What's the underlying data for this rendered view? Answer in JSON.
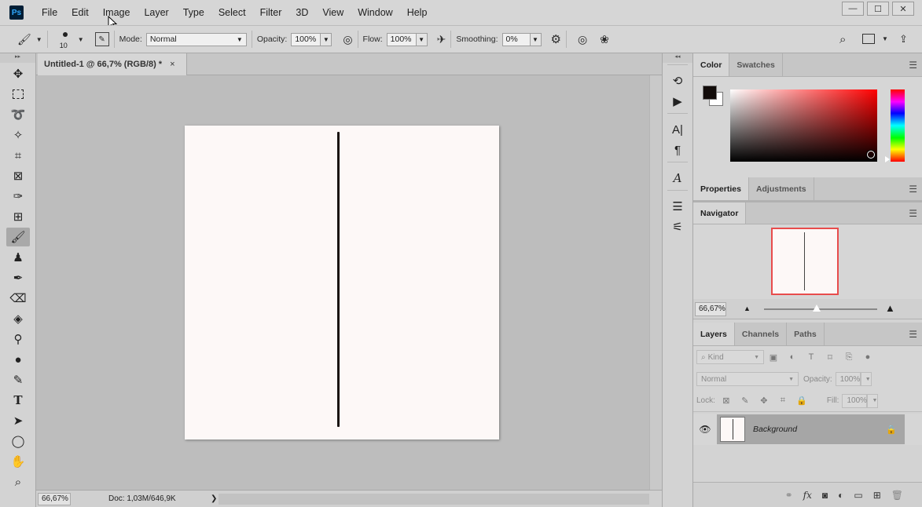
{
  "menubar": {
    "logo": "Ps",
    "items": [
      "File",
      "Edit",
      "Image",
      "Layer",
      "Type",
      "Select",
      "Filter",
      "3D",
      "View",
      "Window",
      "Help"
    ],
    "window_controls": [
      "—",
      "☐",
      "✕"
    ]
  },
  "options": {
    "brush_size": "10",
    "mode_label": "Mode:",
    "mode_value": "Normal",
    "opacity_label": "Opacity:",
    "opacity_value": "100%",
    "flow_label": "Flow:",
    "flow_value": "100%",
    "smoothing_label": "Smoothing:",
    "smoothing_value": "0%"
  },
  "document": {
    "tab_title": "Untitled-1 @ 66,7% (RGB/8) *",
    "tab_close": "×",
    "status_zoom": "66,67%",
    "status_doc": "Doc: 1,03M/646,9K",
    "status_arrow": "❯"
  },
  "panels": {
    "color_tabs": [
      "Color",
      "Swatches"
    ],
    "properties_tabs": [
      "Properties",
      "Adjustments"
    ],
    "navigator_tab": "Navigator",
    "navigator_zoom": "66,67%",
    "layers_tabs": [
      "Layers",
      "Channels",
      "Paths"
    ],
    "layers_kind_placeholder": "Kind",
    "layers_blend": "Normal",
    "opacity_label": "Opacity:",
    "opacity_value": "100%",
    "lock_label": "Lock:",
    "fill_label": "Fill:",
    "fill_value": "100%",
    "layer_name": "Background"
  },
  "colors": {
    "foreground": "#120c0a",
    "background": "#ffffff",
    "accent": "#e84c4c"
  }
}
